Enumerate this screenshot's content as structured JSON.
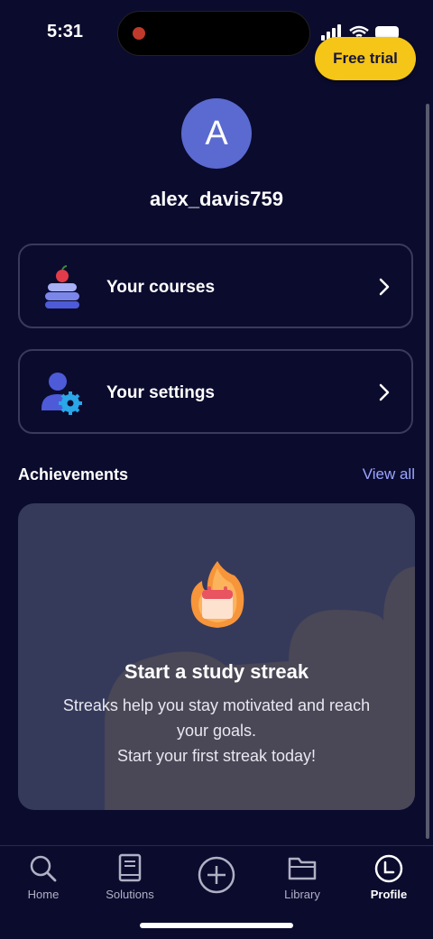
{
  "status_bar": {
    "time": "5:31"
  },
  "header": {
    "trial_button": "Free trial"
  },
  "profile": {
    "avatar_letter": "A",
    "username": "alex_davis759"
  },
  "menu": [
    {
      "label": "Your courses",
      "icon": "courses-stack-icon"
    },
    {
      "label": "Your settings",
      "icon": "user-settings-icon"
    }
  ],
  "achievements": {
    "title": "Achievements",
    "view_all": "View all",
    "card": {
      "title": "Start a study streak",
      "lines": [
        "Streaks help you stay motivated and reach",
        "your goals.",
        "Start your first streak today!"
      ]
    }
  },
  "nav": {
    "items": [
      {
        "label": "Home",
        "icon": "search-icon"
      },
      {
        "label": "Solutions",
        "icon": "book-icon"
      },
      {
        "label": "",
        "icon": "plus-circle-icon"
      },
      {
        "label": "Library",
        "icon": "folder-icon"
      },
      {
        "label": "Profile",
        "icon": "profile-icon",
        "active": true
      }
    ]
  },
  "colors": {
    "background": "#0b0b2e",
    "accent": "#f5c518",
    "link": "#9aa6ff",
    "avatar": "#5b6ad0"
  }
}
